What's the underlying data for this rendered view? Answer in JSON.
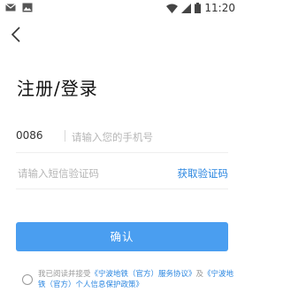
{
  "status_bar": {
    "time": "11:20"
  },
  "page": {
    "title": "注册/登录"
  },
  "phone_row": {
    "country_code": "0086",
    "placeholder": "请输入您的手机号"
  },
  "code_row": {
    "placeholder": "请输入短信验证码",
    "get_code_label": "获取验证码"
  },
  "confirm_label": "确认",
  "agreement": {
    "prefix": "我已阅读并接受",
    "service_link": "《宁波地铁（官方）服务协议》",
    "conjunction": "及",
    "privacy_link": "《宁波地铁（官方）个人信息保护政策》"
  },
  "icons": {
    "back": "chevron-left-icon",
    "gmail": "mail-icon",
    "image": "image-icon",
    "wifi": "wifi-icon",
    "signal": "signal-icon",
    "battery": "battery-icon"
  },
  "colors": {
    "accent": "#2a86e0",
    "button": "#4a9ef0"
  }
}
